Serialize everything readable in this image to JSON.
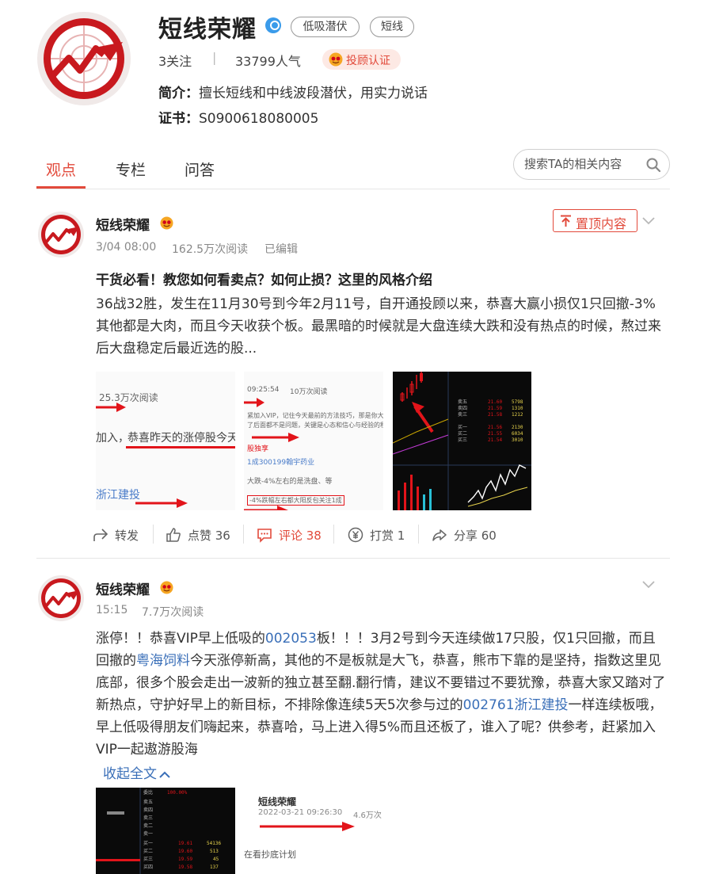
{
  "profile": {
    "name": "短线荣耀",
    "tags": [
      "低吸潜伏",
      "短线"
    ],
    "follow_count": "3关注",
    "separator": "|",
    "popularity": "33799人气",
    "advisor_badge": "投顾认证",
    "intro_label": "简介：",
    "intro_text": "擅长短线和中线波段潜伏，用实力说话",
    "cert_label": "证书：",
    "cert_number": "S0900618080005"
  },
  "tabs": [
    {
      "label": "观点",
      "active": true
    },
    {
      "label": "专栏",
      "active": false
    },
    {
      "label": "问答",
      "active": false
    }
  ],
  "search": {
    "placeholder": "搜索TA的相关内容",
    "icon": "search-icon"
  },
  "colors": {
    "accent": "#e24a3b",
    "link": "#3a6fb8",
    "verified": "#3a9bea"
  },
  "posts": [
    {
      "author": "短线荣耀",
      "time": "3/04 08:00",
      "reads": "162.5万次阅读",
      "edited": "已编辑",
      "pinned_label": "置顶内容",
      "title": "干货必看！教您如何看卖点？如何止损？这里的风格介绍",
      "body": "36战32胜，发生在11月30号到今年2月11号，自开通投顾以来，恭喜大赢小损仅1只回撤-3% 其他都是大肉，而且今天收获个板。最黑暗的时候就是大盘连续大跌和没有热点的时候，熬过来后大盘稳定后最近选的股...",
      "images": [
        {
          "texts": [
            "25.3万次阅读",
            "加入，",
            "恭喜昨天的涨停股今天最高",
            "浙江建投"
          ]
        },
        {
          "texts": [
            "09:25:54",
            "10万次阅读",
            "紧加入VIP，记住今天最前的方法技巧，那是你大赢小损",
            "了后面都不是问题，关键是心态和信心与经验的积累。",
            "股独享",
            "1成300199翰宇药业",
            "大跌-4%左右的是洗盘、等",
            "-4%跌幅左右都大阳反包关注1成"
          ]
        },
        {
          "texts": []
        }
      ],
      "actions": [
        {
          "label": "转发",
          "icon": "share-forward-icon"
        },
        {
          "label": "点赞 36",
          "icon": "thumb-up-icon"
        },
        {
          "label": "评论 38",
          "icon": "comment-icon"
        },
        {
          "label": "打赏 1",
          "icon": "yuan-reward-icon"
        },
        {
          "label": "分享 60",
          "icon": "share-arrow-icon"
        }
      ]
    },
    {
      "author": "短线荣耀",
      "time": "15:15",
      "reads": "7.7万次阅读",
      "body_parts": [
        "涨停！！恭喜VIP早上低吸的",
        "002053",
        "板！！！3月2号到今天连续做17只股，仅1只回撤，而且回撤的",
        "粤海饲料",
        "今天涨停新高，其他的不是板就是大飞，恭喜，熊市下靠的是坚持，指数这里见底部，很多个股会走出一波新的独立甚至翻.翻行情，建议不要错过不要犹豫，恭喜大家又踏对了新热点，守护好早上的新目标，不排除像连续5天5次参与过的",
        "002761浙江建投",
        "一样连续板哦，早上低吸得朋友们嗨起来，恭喜哈，马上进入得5%而且还板了，谁入了呢？供参考，赶紧加入VIP一起遨游股海"
      ],
      "collapse_label": "收起全文",
      "images": [
        {
          "texts": []
        },
        {
          "texts": [
            "短线荣耀",
            "2022-03-21 09:26:30",
            "4.6万次",
            "在看抄底计划"
          ]
        }
      ]
    }
  ]
}
